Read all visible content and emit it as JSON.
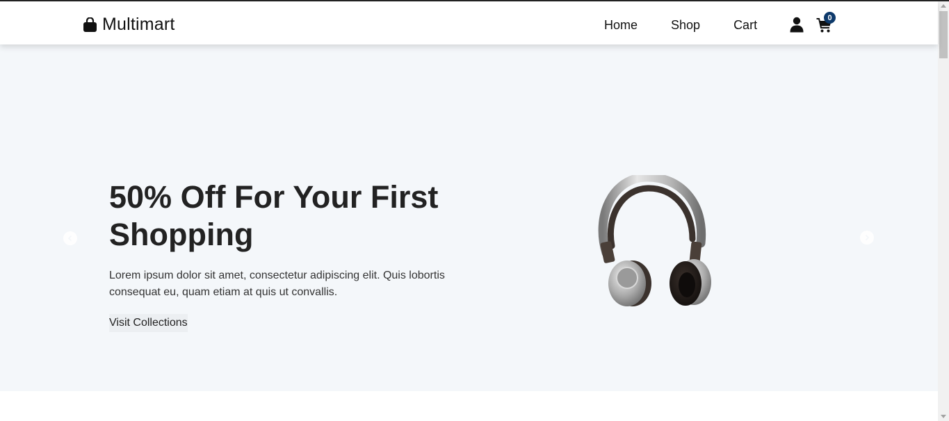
{
  "navbar": {
    "brand": {
      "name": "Multimart",
      "icon": "shopping-bag-icon"
    },
    "links": [
      {
        "label": "Home"
      },
      {
        "label": "Shop"
      },
      {
        "label": "Cart"
      }
    ],
    "user_icon": "user-icon",
    "cart": {
      "icon": "cart-icon",
      "count": "0",
      "badge_color": "#0e3a6b"
    }
  },
  "hero": {
    "title": "50% Off For Your First Shopping",
    "description": "Lorem ipsum dolor sit amet, consectetur adipiscing elit. Quis lobortis consequat eu, quam etiam at quis ut convallis.",
    "button_label": "Visit Collections",
    "image": "headphones-image",
    "background": "#f4f7fa",
    "prev_icon": "chevron-left-icon",
    "next_icon": "chevron-right-icon"
  }
}
